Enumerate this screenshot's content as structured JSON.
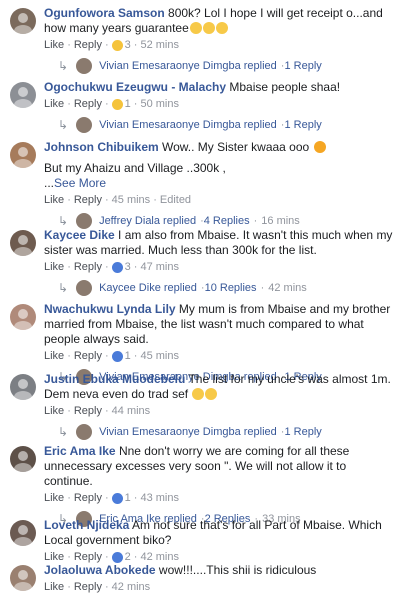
{
  "comments": [
    {
      "name": "Ogunfowora Samson",
      "text": "800k? Lol I hope I will get receipt o...and how many years guarantee",
      "emojis": 3,
      "reaction_icon": "haha",
      "reaction_count": "3",
      "time": "52 mins",
      "like": "Like",
      "reply": "Reply",
      "replies": {
        "author": "Vivian Emesaraonye Dimgba replied",
        "count": "1 Reply",
        "time": ""
      }
    },
    {
      "name": "Ogochukwu Ezeugwu - Malachy",
      "text": "Mbaise people shaa!",
      "emojis": 0,
      "reaction_icon": "haha",
      "reaction_count": "1",
      "time": "50 mins",
      "like": "Like",
      "reply": "Reply",
      "replies": {
        "author": "Vivian Emesaraonye Dimgba replied",
        "count": "1 Reply",
        "time": ""
      }
    },
    {
      "name": "Johnson Chibuikem",
      "text": "Wow.. My Sister kwaaa ooo",
      "text2": "But my Ahaizu and Village ..300k ,",
      "text3": "...",
      "see_more": "See More",
      "emojis": 1,
      "reaction_icon": "",
      "reaction_count": "",
      "time": "45 mins",
      "edited": "Edited",
      "like": "Like",
      "reply": "Reply",
      "replies": {
        "author": "Jeffrey Diala replied",
        "count": "4 Replies",
        "time": "16 mins"
      }
    },
    {
      "name": "Kaycee Dike",
      "text": "I am also from Mbaise. It wasn't this much when my sister was married. Much less than 300k for the list.",
      "emojis": 0,
      "reaction_icon": "like",
      "reaction_count": "3",
      "time": "47 mins",
      "like": "Like",
      "reply": "Reply",
      "replies": {
        "author": "Kaycee Dike replied",
        "count": "10 Replies",
        "time": "42 mins"
      }
    },
    {
      "name": "Nwachukwu Lynda Lily",
      "text": "My mum is from Mbaise and my brother married from Mbaise, the list wasn't much compared to what people always said.",
      "emojis": 0,
      "reaction_icon": "like",
      "reaction_count": "1",
      "time": "45 mins",
      "like": "Like",
      "reply": "Reply",
      "replies": {
        "author": "Vivian Emesaraonye Dimgba replied",
        "count": "1 Reply",
        "time": ""
      }
    },
    {
      "name": "Justin Ebuka Muodebelu",
      "text": "The list for my uncle's was almost 1m.",
      "text2": "Dem neva even do trad sef",
      "emojis": 2,
      "reaction_icon": "",
      "reaction_count": "",
      "time": "44 mins",
      "like": "Like",
      "reply": "Reply",
      "replies": {
        "author": "Vivian Emesaraonye Dimgba replied",
        "count": "1 Reply",
        "time": ""
      }
    },
    {
      "name": "Eric Ama Ike",
      "text": "Nne don't worry we are coming for all these unnecessary excesses very soon \". We will not allow it to continue.",
      "emojis": 0,
      "reaction_icon": "like",
      "reaction_count": "1",
      "time": "43 mins",
      "like": "Like",
      "reply": "Reply",
      "replies": {
        "author": "Eric Ama Ike replied",
        "count": "2 Replies",
        "time": "33 mins"
      }
    },
    {
      "name": "Loveth Njideka",
      "text": "Am not sure that's for all Part of Mbaise. Which Local government biko?",
      "emojis": 0,
      "reaction_icon": "like",
      "reaction_count": "2",
      "time": "42 mins",
      "like": "Like",
      "reply": "Reply",
      "replies": null
    },
    {
      "name": "Jolaoluwa Abokede",
      "text": "wow!!!....This shii is ridiculous",
      "emojis": 0,
      "reaction_icon": "",
      "reaction_count": "",
      "time": "42 mins",
      "like": "Like",
      "reply": "Reply",
      "replies": null
    }
  ]
}
